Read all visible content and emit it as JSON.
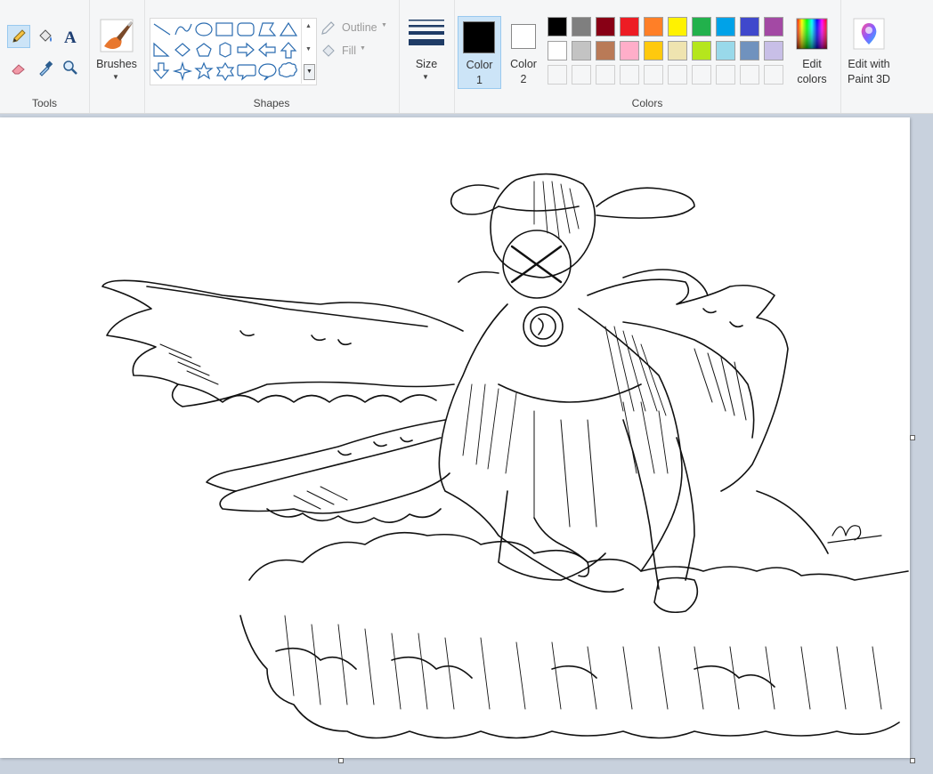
{
  "ribbon": {
    "tools": {
      "label": "Tools"
    },
    "brushes": {
      "label": "Brushes"
    },
    "shapes": {
      "label": "Shapes",
      "outline_label": "Outline",
      "fill_label": "Fill"
    },
    "size": {
      "label": "Size"
    },
    "colors": {
      "label": "Colors",
      "color1_label": "Color\n1",
      "color2_label": "Color\n2",
      "color1_value": "#000000",
      "color2_value": "#ffffff",
      "edit_colors_label": "Edit\ncolors",
      "edit_3d_label": "Edit with\nPaint 3D",
      "palette_row1": [
        "#000000",
        "#7f7f7f",
        "#880015",
        "#ed1c24",
        "#ff7f27",
        "#fff200",
        "#22b14c",
        "#00a2e8",
        "#3f48cc",
        "#a349a4"
      ],
      "palette_row2": [
        "#ffffff",
        "#c3c3c3",
        "#b97a57",
        "#ffaec9",
        "#ffc90e",
        "#efe4b0",
        "#b5e61d",
        "#99d9ea",
        "#7092be",
        "#c8bfe7"
      ]
    }
  }
}
